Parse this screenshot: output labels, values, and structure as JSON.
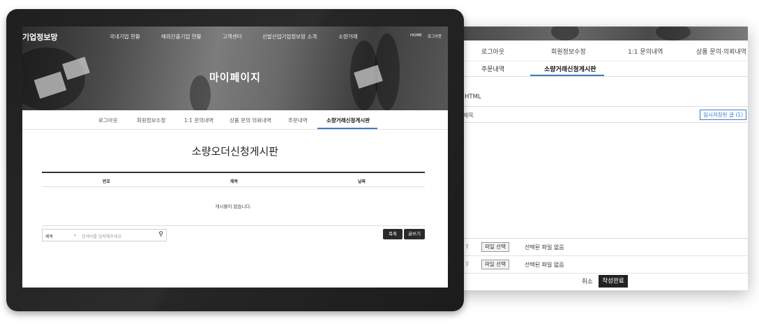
{
  "back_window": {
    "nav_row1": [
      "로그아웃",
      "회원정보수정",
      "1:1 문의내역",
      "상품 문의·의뢰내역"
    ],
    "nav_row2": [
      "주문내역",
      "소량거래신청게시판"
    ],
    "html_label": "] HTML",
    "title_label": "제목",
    "temp_saved_button": "임시저장된 글 (1)",
    "file_rows": [
      {
        "button": "파일 선택",
        "status": "선택된 파일 없음"
      },
      {
        "button": "파일 선택",
        "status": "선택된 파일 없음"
      }
    ],
    "cancel": "취소",
    "submit": "작성완료"
  },
  "front_window": {
    "brand": "기업정보망",
    "top_nav": [
      "국내기업 현황",
      "해외진출기업 현황",
      "고객센터",
      "신발산업기업정보망 소개",
      "소량거래"
    ],
    "utility": [
      "HOME",
      "로그아웃"
    ],
    "hero_title": "마이페이지",
    "sub_nav": [
      "로그아웃",
      "회원정보수정",
      "1:1 문의내역",
      "상품 문의·의뢰내역",
      "주문내역",
      "소량거래신청게시판"
    ],
    "board_title": "소량오더신청게시판",
    "columns": [
      "번호",
      "제목",
      "날짜"
    ],
    "empty_message": "게시물이 없습니다.",
    "search_select": "제목",
    "search_placeholder": "검색어를 입력해주세요",
    "list_button": "목록",
    "write_button": "글쓰기"
  },
  "colors": {
    "accent": "#3b7dc4",
    "dark": "#2a2a2a"
  }
}
